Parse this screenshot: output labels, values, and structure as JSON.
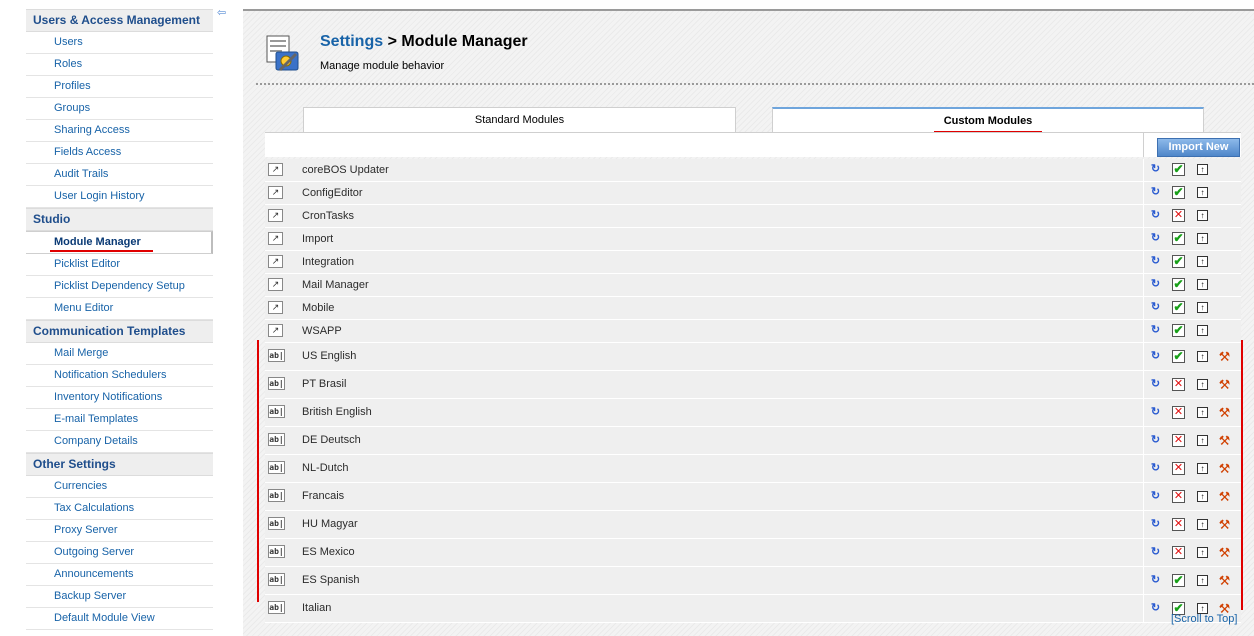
{
  "sidebar": {
    "sections": [
      {
        "heading": "Users & Access Management",
        "items": [
          "Users",
          "Roles",
          "Profiles",
          "Groups",
          "Sharing Access",
          "Fields Access",
          "Audit Trails",
          "User Login History"
        ]
      },
      {
        "heading": "Studio",
        "items": [
          "Module Manager",
          "Picklist Editor",
          "Picklist Dependency Setup",
          "Menu Editor"
        ]
      },
      {
        "heading": "Communication Templates",
        "items": [
          "Mail Merge",
          "Notification Schedulers",
          "Inventory Notifications",
          "E-mail Templates",
          "Company Details"
        ]
      },
      {
        "heading": "Other Settings",
        "items": [
          "Currencies",
          "Tax Calculations",
          "Proxy Server",
          "Outgoing Server",
          "Announcements",
          "Backup Server",
          "Default Module View"
        ]
      }
    ],
    "active_item": "Module Manager"
  },
  "header": {
    "breadcrumb_link": "Settings",
    "breadcrumb_sep": " > ",
    "title": "Module Manager",
    "subtitle": "Manage module behavior"
  },
  "tabs": {
    "standard": "Standard Modules",
    "custom": "Custom Modules",
    "active": "custom"
  },
  "import_button": "Import New",
  "modules": [
    {
      "name": "coreBOS Updater",
      "kind": "module",
      "enabled": true
    },
    {
      "name": "ConfigEditor",
      "kind": "module",
      "enabled": true
    },
    {
      "name": "CronTasks",
      "kind": "module",
      "enabled": false
    },
    {
      "name": "Import",
      "kind": "module",
      "enabled": true
    },
    {
      "name": "Integration",
      "kind": "module",
      "enabled": true
    },
    {
      "name": "Mail Manager",
      "kind": "module",
      "enabled": true
    },
    {
      "name": "Mobile",
      "kind": "module",
      "enabled": true
    },
    {
      "name": "WSAPP",
      "kind": "module",
      "enabled": true
    },
    {
      "name": "US English",
      "kind": "language",
      "enabled": true
    },
    {
      "name": "PT Brasil",
      "kind": "language",
      "enabled": false
    },
    {
      "name": "British English",
      "kind": "language",
      "enabled": false
    },
    {
      "name": "DE Deutsch",
      "kind": "language",
      "enabled": false
    },
    {
      "name": "NL-Dutch",
      "kind": "language",
      "enabled": false
    },
    {
      "name": "Francais",
      "kind": "language",
      "enabled": false
    },
    {
      "name": "HU Magyar",
      "kind": "language",
      "enabled": false
    },
    {
      "name": "ES Mexico",
      "kind": "language",
      "enabled": false
    },
    {
      "name": "ES Spanish",
      "kind": "language",
      "enabled": true
    },
    {
      "name": "Italian",
      "kind": "language",
      "enabled": true
    }
  ],
  "icons": {
    "module_row": "external-link-icon",
    "language_row": "text-field-icon",
    "language_glyph": "ab|",
    "refresh": "refresh-icon",
    "enabled": "check-icon",
    "disabled": "cross-icon",
    "export": "export-icon",
    "settings": "wrench-icon",
    "collapse": "collapse-sidebar-icon"
  },
  "colors": {
    "link": "#1863a8",
    "accent_red": "#e00000",
    "header_blue": "#1f4e8c"
  },
  "footer": {
    "scroll_top": "[Scroll to Top]"
  }
}
